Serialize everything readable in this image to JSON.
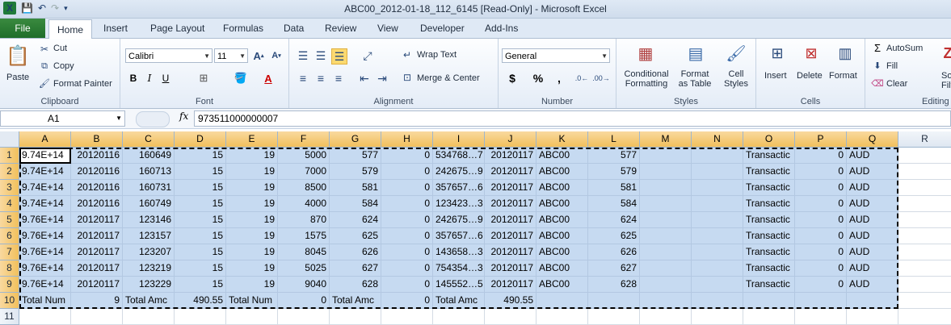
{
  "window": {
    "title": "ABC00_2012-01-18_112_6145  [Read-Only]  -  Microsoft Excel"
  },
  "tabs": [
    "File",
    "Home",
    "Insert",
    "Page Layout",
    "Formulas",
    "Data",
    "Review",
    "View",
    "Developer",
    "Add-Ins"
  ],
  "clipboard": {
    "paste": "Paste",
    "cut": "Cut",
    "copy": "Copy",
    "format_painter": "Format Painter",
    "label": "Clipboard"
  },
  "font": {
    "name": "Calibri",
    "size": "11",
    "label": "Font"
  },
  "alignment": {
    "wrap": "Wrap Text",
    "merge": "Merge & Center",
    "label": "Alignment"
  },
  "number": {
    "format": "General",
    "label": "Number"
  },
  "styles": {
    "conditional_1": "Conditional",
    "conditional_2": "Formatting",
    "table_1": "Format",
    "table_2": "as Table",
    "cell_1": "Cell",
    "cell_2": "Styles",
    "label": "Styles"
  },
  "cells": {
    "insert": "Insert",
    "delete": "Delete",
    "format": "Format",
    "label": "Cells"
  },
  "editing": {
    "autosum": "AutoSum",
    "fill": "Fill",
    "clear": "Clear",
    "label": "Editing",
    "sort_1": "Sor",
    "sort_2": "Filt"
  },
  "formula_bar": {
    "name_box": "A1",
    "fx": "fx",
    "value": "973511000000007"
  },
  "grid": {
    "columns": [
      "A",
      "B",
      "C",
      "D",
      "E",
      "F",
      "G",
      "H",
      "I",
      "J",
      "K",
      "L",
      "M",
      "N",
      "O",
      "P",
      "Q",
      "R"
    ],
    "rows": [
      "1",
      "2",
      "3",
      "4",
      "5",
      "6",
      "7",
      "8",
      "9",
      "10",
      "11"
    ],
    "data": [
      [
        "9.74E+14",
        "20120116",
        "160649",
        "15",
        "19",
        "5000",
        "577",
        "0",
        "534768…7",
        "20120117",
        "ABC00",
        "577",
        "",
        "",
        "Transactic",
        "0",
        "AUD"
      ],
      [
        "9.74E+14",
        "20120116",
        "160713",
        "15",
        "19",
        "7000",
        "579",
        "0",
        "242675…9",
        "20120117",
        "ABC00",
        "579",
        "",
        "",
        "Transactic",
        "0",
        "AUD"
      ],
      [
        "9.74E+14",
        "20120116",
        "160731",
        "15",
        "19",
        "8500",
        "581",
        "0",
        "357657…6",
        "20120117",
        "ABC00",
        "581",
        "",
        "",
        "Transactic",
        "0",
        "AUD"
      ],
      [
        "9.74E+14",
        "20120116",
        "160749",
        "15",
        "19",
        "4000",
        "584",
        "0",
        "123423…3",
        "20120117",
        "ABC00",
        "584",
        "",
        "",
        "Transactic",
        "0",
        "AUD"
      ],
      [
        "9.76E+14",
        "20120117",
        "123146",
        "15",
        "19",
        "870",
        "624",
        "0",
        "242675…9",
        "20120117",
        "ABC00",
        "624",
        "",
        "",
        "Transactic",
        "0",
        "AUD"
      ],
      [
        "9.76E+14",
        "20120117",
        "123157",
        "15",
        "19",
        "1575",
        "625",
        "0",
        "357657…6",
        "20120117",
        "ABC00",
        "625",
        "",
        "",
        "Transactic",
        "0",
        "AUD"
      ],
      [
        "9.76E+14",
        "20120117",
        "123207",
        "15",
        "19",
        "8045",
        "626",
        "0",
        "143658…3",
        "20120117",
        "ABC00",
        "626",
        "",
        "",
        "Transactic",
        "0",
        "AUD"
      ],
      [
        "9.76E+14",
        "20120117",
        "123219",
        "15",
        "19",
        "5025",
        "627",
        "0",
        "754354…3",
        "20120117",
        "ABC00",
        "627",
        "",
        "",
        "Transactic",
        "0",
        "AUD"
      ],
      [
        "9.76E+14",
        "20120117",
        "123229",
        "15",
        "19",
        "9040",
        "628",
        "0",
        "145552…5",
        "20120117",
        "ABC00",
        "628",
        "",
        "",
        "Transactic",
        "0",
        "AUD"
      ],
      [
        "Total Num",
        "9",
        "Total Amc",
        "490.55",
        "Total Num",
        "0",
        "Total Amc",
        "0",
        "Total Amc",
        "490.55",
        "",
        "",
        "",
        "",
        "",
        "",
        ""
      ]
    ]
  }
}
